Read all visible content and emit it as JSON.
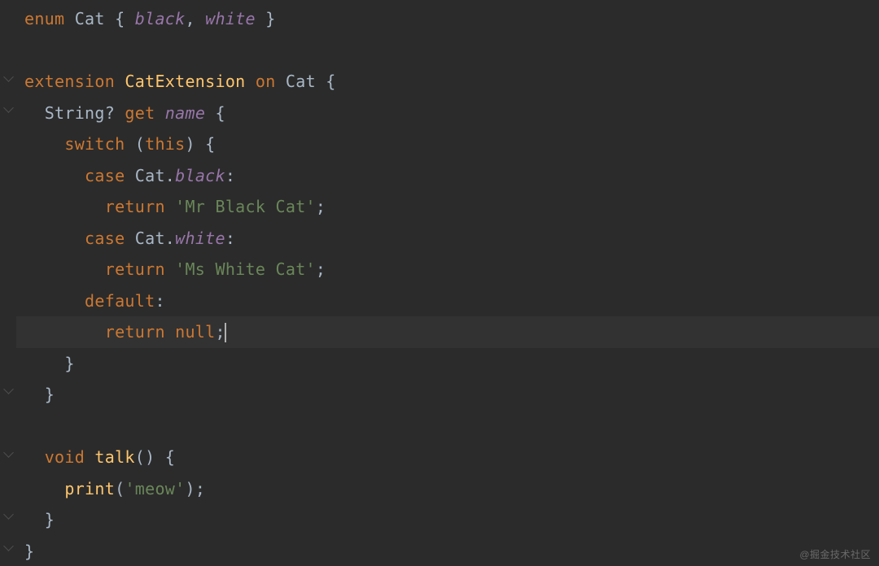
{
  "code": {
    "line1": {
      "kw_enum": "enum",
      "type": "Cat",
      "brace_l": " { ",
      "v1": "black",
      "comma": ", ",
      "v2": "white",
      "brace_r": " }"
    },
    "line3": {
      "kw_ext": "extension",
      "name": "CatExtension",
      "kw_on": "on",
      "type": "Cat",
      "brace": " {"
    },
    "line4": {
      "type": "String",
      "q": "?",
      "kw_get": "get",
      "prop": "name",
      "brace": " {"
    },
    "line5": {
      "kw_switch": "switch",
      "paren_l": " (",
      "kw_this": "this",
      "paren_r": ") {"
    },
    "line6": {
      "kw_case": "case",
      "type": "Cat",
      "dot": ".",
      "val": "black",
      "colon": ":"
    },
    "line7": {
      "kw_return": "return",
      "str": "'Mr Black Cat'",
      "semi": ";"
    },
    "line8": {
      "kw_case": "case",
      "type": "Cat",
      "dot": ".",
      "val": "white",
      "colon": ":"
    },
    "line9": {
      "kw_return": "return",
      "str": "'Ms White Cat'",
      "semi": ";"
    },
    "line10": {
      "kw_default": "default",
      "colon": ":"
    },
    "line11": {
      "kw_return": "return",
      "kw_null": "null",
      "semi": ";"
    },
    "line12": {
      "brace": "}"
    },
    "line13": {
      "brace": "}"
    },
    "line15": {
      "kw_void": "void",
      "fn": "talk",
      "parens": "() {"
    },
    "line16": {
      "fn": "print",
      "paren_l": "(",
      "str": "'meow'",
      "paren_r": ");"
    },
    "line17": {
      "brace": "}"
    },
    "line18": {
      "brace": "}"
    }
  },
  "watermark": "@掘金技术社区"
}
